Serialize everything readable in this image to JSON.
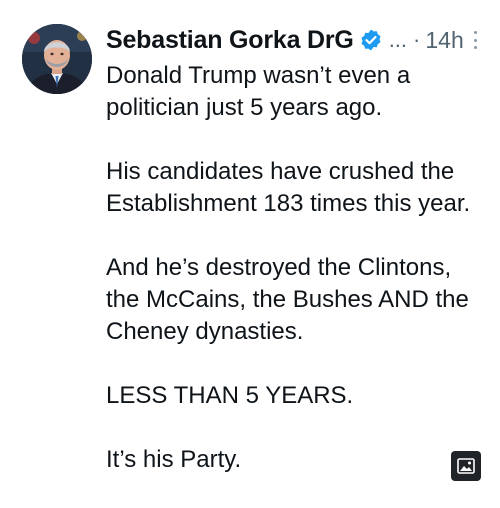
{
  "author": {
    "name": "Sebastian Gorka DrG",
    "handle_truncated": "...",
    "separator": "·",
    "timestamp": "14h",
    "verified": true,
    "verified_color": "#1d9bf0"
  },
  "tweet": {
    "paragraphs": [
      [
        "Donald Trump wasn’t even a",
        "politician just 5 years ago."
      ],
      [
        "His candidates have crushed the",
        "Establishment 183 times this year."
      ],
      [
        "And he’s destroyed the Clintons,",
        "the McCains, the Bushes AND the",
        "Cheney dynasties."
      ],
      [
        "LESS THAN 5 YEARS."
      ],
      [
        "It’s his Party."
      ]
    ]
  },
  "icons": {
    "verified": "verified-badge-icon",
    "more": "more-vertical-icon",
    "media": "image-icon"
  },
  "colors": {
    "text": "#0f1419",
    "secondary": "#536471",
    "background": "#ffffff"
  }
}
